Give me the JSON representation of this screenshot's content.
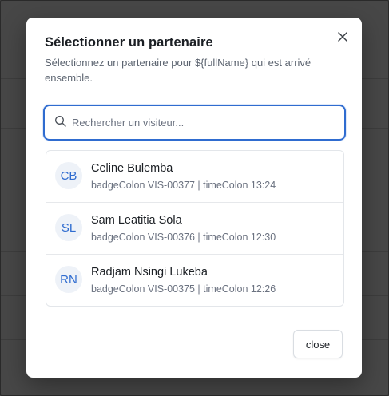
{
  "modal": {
    "title": "Sélectionner un partenaire",
    "description": "Sélectionnez un partenaire pour ${fullName} qui est arrivé ensemble.",
    "close_icon": "close-icon",
    "close_button_label": "close"
  },
  "search": {
    "placeholder": "Rechercher un visiteur...",
    "value": "",
    "icon": "search-icon",
    "accent_color": "#2f6cd0"
  },
  "visitors": [
    {
      "initials": "CB",
      "name": "Celine Bulemba",
      "meta": "badgeColon VIS-00377 | timeColon 13:24"
    },
    {
      "initials": "SL",
      "name": "Sam Leatitia Sola",
      "meta": "badgeColon VIS-00376 | timeColon 12:30"
    },
    {
      "initials": "RN",
      "name": "Radjam Nsingi Lukeba",
      "meta": "badgeColon VIS-00375 | timeColon 12:26"
    }
  ]
}
